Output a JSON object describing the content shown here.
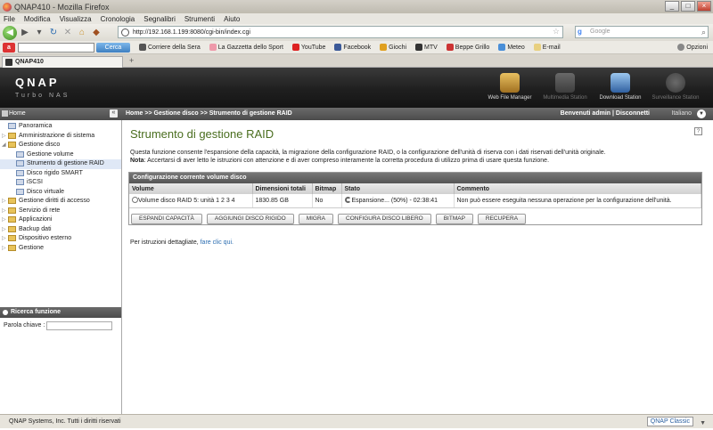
{
  "browser": {
    "window_title": "QNAP410 - Mozilla Firefox",
    "menu": [
      "File",
      "Modifica",
      "Visualizza",
      "Cronologia",
      "Segnalibri",
      "Strumenti",
      "Aiuto"
    ],
    "url": "http://192.168.1.199:8080/cgi-bin/index.cgi",
    "search_placeholder": "Google",
    "ask_value": "",
    "cerca_label": "Cerca",
    "bookmarks": [
      "Corriere della Sera",
      "La Gazzetta dello Sport",
      "YouTube",
      "Facebook",
      "Giochi",
      "MTV",
      "Beppe Grillo",
      "Meteo",
      "E-mail"
    ],
    "opzioni_label": "Opzioni",
    "tab_label": "QNAP410"
  },
  "header": {
    "logo": "QNAP",
    "sublogo": "Turbo NAS",
    "apps": [
      {
        "label": "Web File Manager"
      },
      {
        "label": "Multimedia Station"
      },
      {
        "label": "Download Station"
      },
      {
        "label": "Surveillance Station"
      }
    ]
  },
  "breadcrumb_bar": {
    "home": "Home",
    "crumb": "Home >> Gestione disco >> Strumento di gestione RAID",
    "welcome": "Benvenuti admin | Disconnetti",
    "language": "Italiano"
  },
  "sidebar": {
    "tree": [
      "Panoramica",
      "Amministrazione di sistema",
      "Gestione disco",
      "Gestione volume",
      "Strumento di gestione RAID",
      "Disco rigido SMART",
      "iSCSI",
      "Disco virtuale",
      "Gestione diritti di accesso",
      "Servizio di rete",
      "Applicazioni",
      "Backup dati",
      "Dispositivo esterno",
      "Gestione"
    ],
    "search_title": "Ricerca funzione",
    "search_label": "Parola chiave :",
    "search_value": ""
  },
  "main": {
    "title": "Strumento di gestione RAID",
    "desc_line1": "Questa funzione consente l'espansione della capacità, la migrazione della configurazione RAID, o la configurazione dell'unità di riserva con i dati riservati dell'unità originale.",
    "desc_note_label": "Nota",
    "desc_note": ": Accertarsi di aver letto le istruzioni con attenzione e di aver compreso interamente la corretta procedura di utilizzo prima di usare questa funzione.",
    "group_title": "Configurazione corrente volume disco",
    "columns": [
      "Volume",
      "Dimensioni totali",
      "Bitmap",
      "Stato",
      "Commento"
    ],
    "row": {
      "volume": "Volume disco RAID 5: unità 1 2 3 4",
      "size": "1830.85 GB",
      "bitmap": "No",
      "stato": "Espansione... (50%) - 02:38:41",
      "commento": "Non può essere eseguita nessuna operazione per la configurazione dell'unità."
    },
    "buttons": [
      "ESPANDI CAPACITÀ",
      "AGGIUNGI DISCO RIGIDO",
      "MIGRA",
      "CONFIGURA DISCO LIBERO",
      "BITMAP",
      "RECUPERA"
    ],
    "footnote_text": "Per istruzioni dettagliate, ",
    "footnote_link": "fare clic qui."
  },
  "status": {
    "copyright": "QNAP Systems, Inc. Tutti i diritti riservati",
    "classic": "QNAP Classic"
  }
}
